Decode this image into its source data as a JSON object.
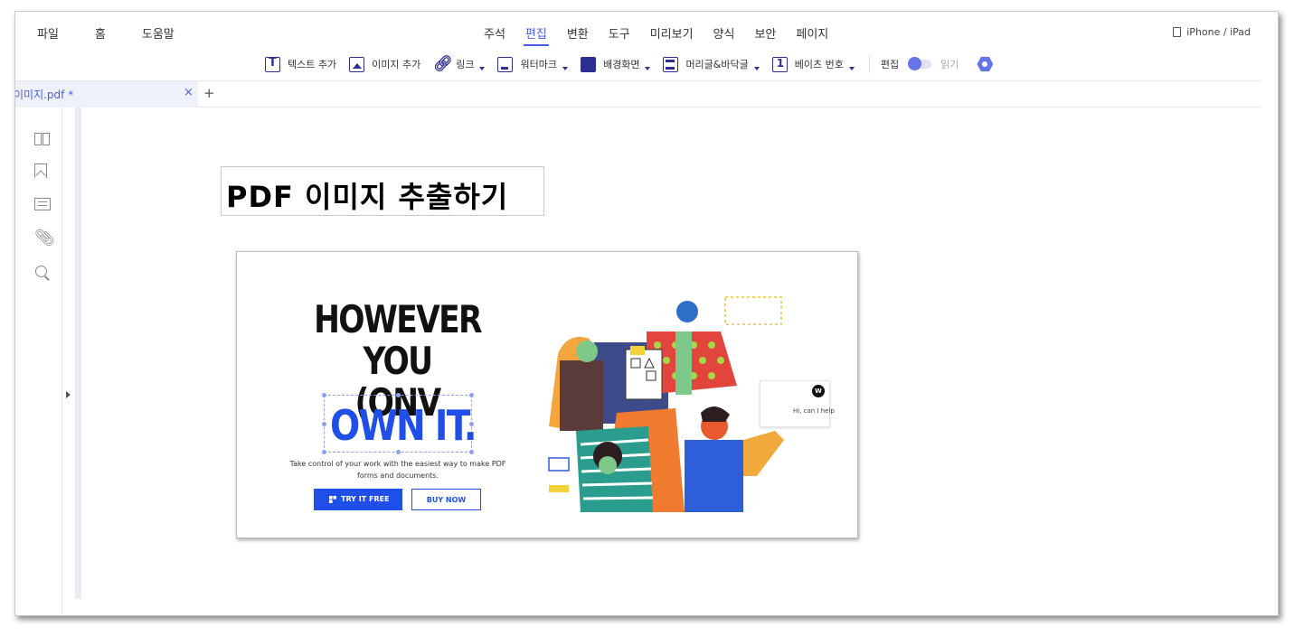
{
  "menu": {
    "left": [
      "파일",
      "홈",
      "도움말"
    ],
    "center": [
      "주석",
      "편집",
      "변환",
      "도구",
      "미리보기",
      "양식",
      "보안",
      "페이지"
    ],
    "active": "편집",
    "device_label": "iPhone / iPad"
  },
  "toolbar": {
    "add_text": "텍스트 추가",
    "add_image": "이미지 추가",
    "link": "링크",
    "watermark": "워터마크",
    "background": "배경화면",
    "header_footer": "머리글&바닥글",
    "bates": "베이츠 번호",
    "edit_label": "편집",
    "read_label": "읽기"
  },
  "tab": {
    "filename": "이미지.pdf *",
    "close": "×",
    "add": "+"
  },
  "document": {
    "title": "PDF 이미지 추출하기",
    "embedded_image": {
      "headline_line1": "HOWEVER YOU",
      "headline_line2": "(ONV",
      "highlight": "OWN IT.",
      "description": "Take control of your work with the easiest way to make PDF forms and documents.",
      "try_button": "TRY IT FREE",
      "buy_button": "BUY NOW",
      "chat_text": "Hi, can I help"
    }
  },
  "colors": {
    "accent": "#4a5fe0",
    "icon": "#2c2f8f",
    "brand_blue": "#1f4fe8"
  }
}
